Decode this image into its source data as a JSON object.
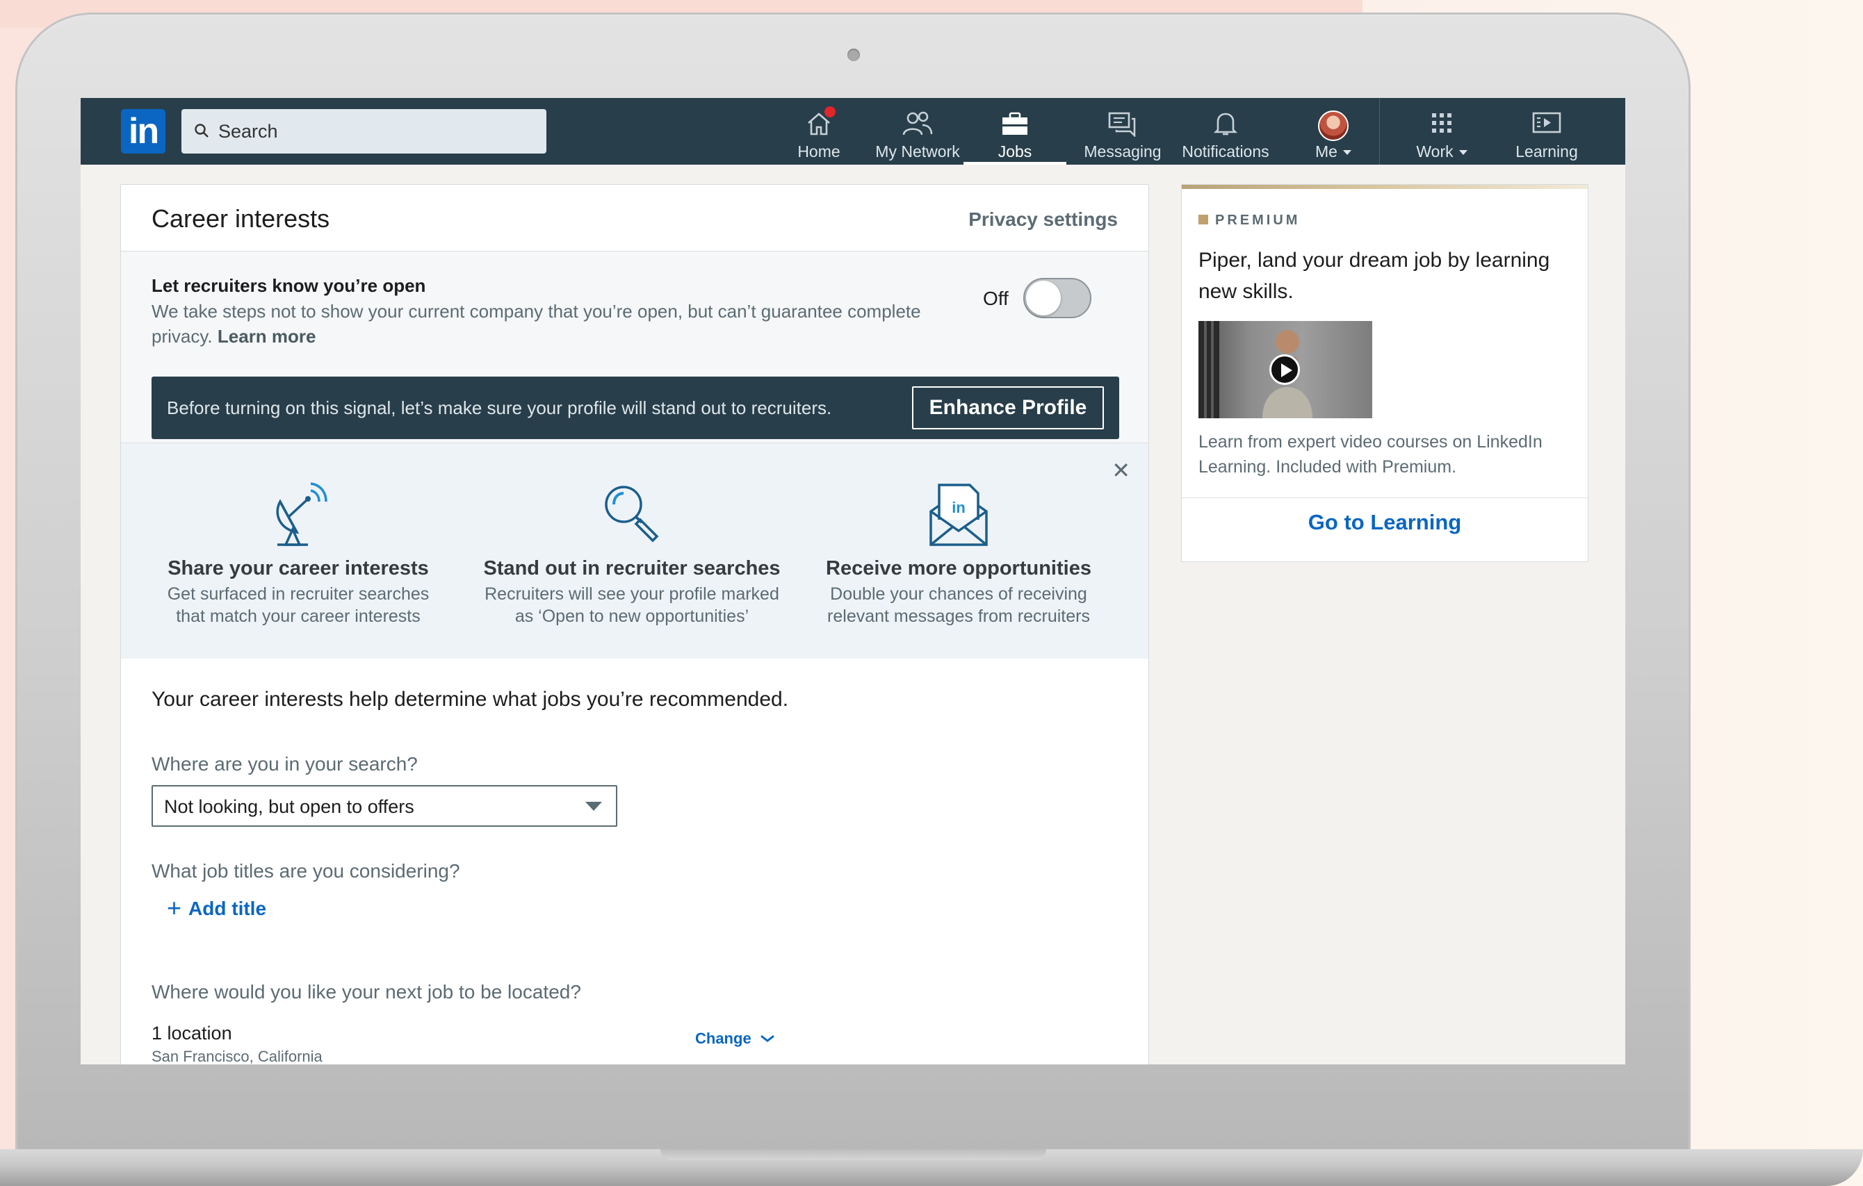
{
  "nav": {
    "search_placeholder": "Search",
    "items": [
      {
        "label": "Home",
        "icon": "home-icon",
        "badge": true
      },
      {
        "label": "My Network",
        "icon": "network-icon"
      },
      {
        "label": "Jobs",
        "icon": "briefcase-icon",
        "active": true
      },
      {
        "label": "Messaging",
        "icon": "messaging-icon"
      },
      {
        "label": "Notifications",
        "icon": "bell-icon"
      },
      {
        "label": "Me",
        "icon": "avatar",
        "dropdown": true
      },
      {
        "label": "Work",
        "icon": "grid-icon",
        "dropdown": true
      },
      {
        "label": "Learning",
        "icon": "learning-icon"
      }
    ]
  },
  "career": {
    "title": "Career interests",
    "privacy_link": "Privacy settings",
    "open": {
      "title": "Let recruiters know you’re open",
      "desc": "We take steps not to show your current company that you’re open, but can’t guarantee complete privacy.",
      "learn_more": "Learn more",
      "toggle_label": "Off"
    },
    "banner": {
      "text": "Before turning on this signal, let’s make sure your profile will stand out to recruiters.",
      "button": "Enhance Profile"
    },
    "features": [
      {
        "title": "Share your career interests",
        "desc1": "Get surfaced in recruiter searches",
        "desc2": "that match your career interests",
        "icon": "satellite-dish-icon"
      },
      {
        "title": "Stand out in recruiter searches",
        "desc1": "Recruiters will see your profile marked",
        "desc2": "as ‘Open to new opportunities’",
        "icon": "magnifier-icon"
      },
      {
        "title": "Receive more opportunities",
        "desc1": "Double your chances of receiving",
        "desc2": "relevant messages from recruiters",
        "icon": "envelope-in-icon"
      }
    ],
    "intro": "Your career interests help determine what jobs you’re recommended.",
    "q_search": "Where are you in your search?",
    "search_status": "Not looking, but open to offers",
    "q_titles": "What job titles are you considering?",
    "add_title": "Add title",
    "q_location": "Where would you like your next job to be located?",
    "location_count": "1 location",
    "location_name": "San Francisco, California",
    "change": "Change"
  },
  "premium": {
    "label": "PREMIUM",
    "headline": "Piper, land your dream job by learning new skills.",
    "desc": "Learn from expert video courses on LinkedIn Learning. Included with Premium.",
    "link": "Go to Learning"
  },
  "colors": {
    "nav": "#283e4a",
    "link": "#0a66c2",
    "premium_gold": "#c0a16b"
  }
}
